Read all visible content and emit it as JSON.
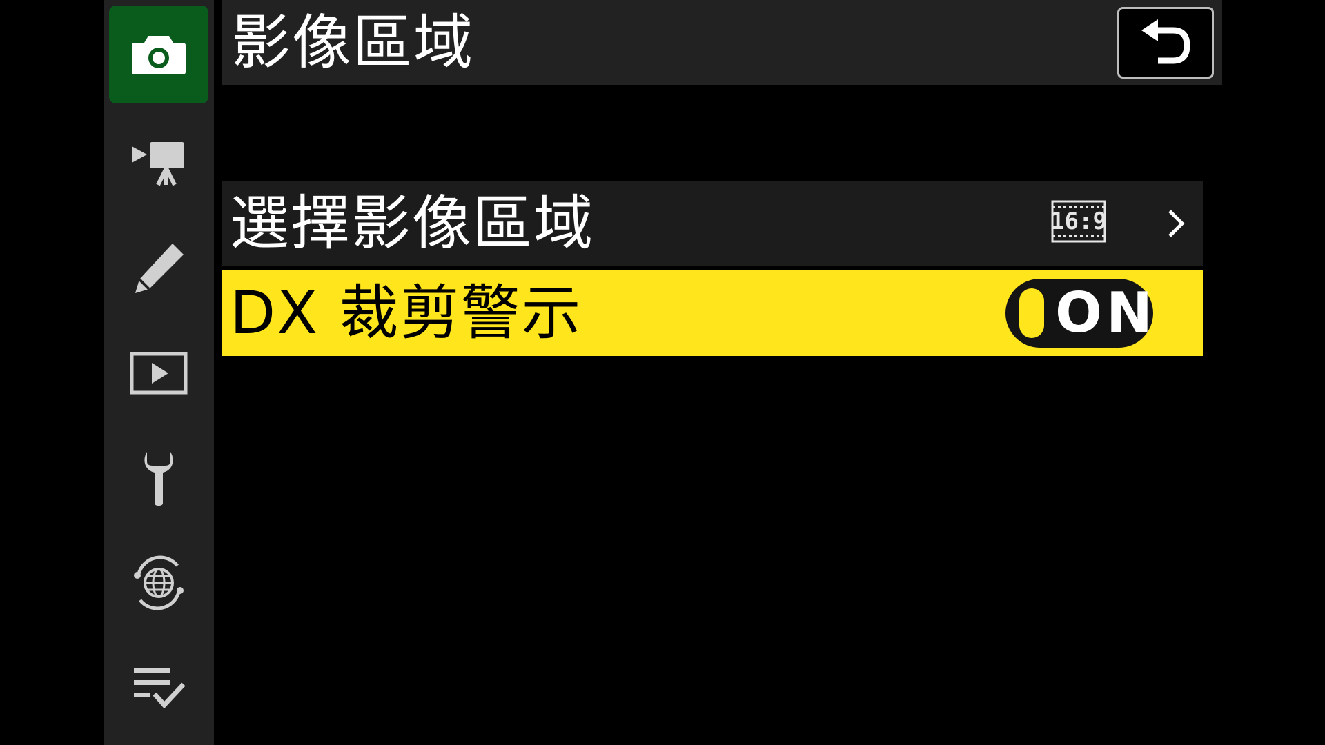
{
  "sidebar": {
    "items": [
      {
        "name": "photo-shooting-menu",
        "icon": "camera-icon",
        "active": true
      },
      {
        "name": "video-recording-menu",
        "icon": "movie-camera-icon",
        "active": false
      },
      {
        "name": "custom-settings-menu",
        "icon": "pencil-icon",
        "active": false
      },
      {
        "name": "playback-menu",
        "icon": "play-icon",
        "active": false
      },
      {
        "name": "setup-menu",
        "icon": "wrench-icon",
        "active": false
      },
      {
        "name": "network-menu",
        "icon": "network-globe-icon",
        "active": false
      },
      {
        "name": "my-menu",
        "icon": "checklist-icon",
        "active": false
      }
    ],
    "active_color": "#0a5c1c"
  },
  "header": {
    "title": "影像區域",
    "back_icon": "return-arrow-icon"
  },
  "menu": {
    "rows": [
      {
        "label": "選擇影像區域",
        "value": "16:9",
        "value_icon": "aspect-ratio-16-9-icon",
        "has_submenu": true
      },
      {
        "label": "DX 裁剪警示",
        "value": "ON",
        "toggle_on": true
      }
    ],
    "highlight_color": "#ffe51c"
  }
}
